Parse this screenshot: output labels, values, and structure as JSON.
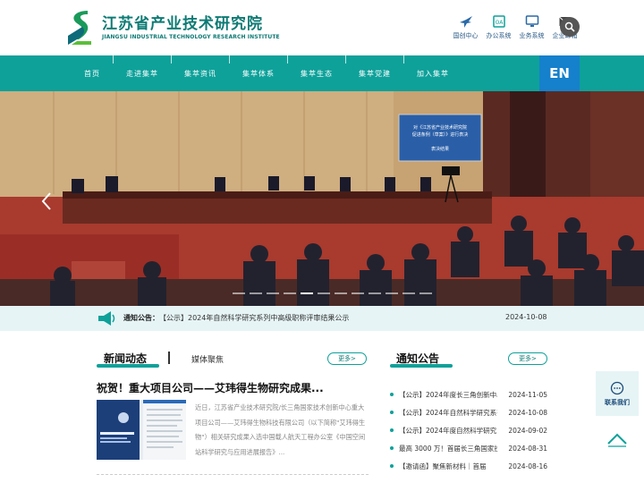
{
  "header": {
    "logo_cn": "江苏省产业技术研究院",
    "logo_en": "JIANGSU INDUSTRIAL TECHNOLOGY RESEARCH INSTITUTE",
    "top_links": [
      {
        "label": "国创中心",
        "icon": "bird-icon"
      },
      {
        "label": "办公系统",
        "icon": "oa-icon"
      },
      {
        "label": "业务系统",
        "icon": "monitor-icon"
      },
      {
        "label": "企业邮箱",
        "icon": "mail-icon"
      }
    ],
    "search_icon": "search-icon"
  },
  "nav": {
    "items": [
      "首页",
      "走进集萃",
      "集萃资讯",
      "集萃体系",
      "集萃生态",
      "集萃党建",
      "加入集萃"
    ],
    "en_label": "EN"
  },
  "banner": {
    "screen_text_1": "对《江苏省产业技术研究院",
    "screen_text_2": "促进条例（草案）》进行表决",
    "screen_text_3": "表决结果"
  },
  "notice_bar": {
    "label": "通知公告：",
    "text": "【公示】2024年自然科学研究系列中高级职称评审结果公示",
    "date": "2024-10-08"
  },
  "news": {
    "title": "新闻动态",
    "tab2": "媒体聚焦",
    "more": "更多>",
    "headline": "祝贺！重大项目公司——艾玮得生物研究成果...",
    "summary": "近日，江苏省产业技术研究院/长三角国家技术创新中心重大项目公司——艾玮得生物科技有限公司（以下简称\"艾玮得生物\"）相关研究成果入选中国载人航天工程办公室《中国空间站科学研究与应用进展报告》..."
  },
  "notices": {
    "title": "通知公告",
    "more": "更多>",
    "items": [
      {
        "title": "【公示】2024年度长三角创新中心",
        "date": "2024-11-05"
      },
      {
        "title": "【公示】2024年自然科学研究系列",
        "date": "2024-10-08"
      },
      {
        "title": "【公示】2024年度自然科学研究",
        "date": "2024-09-02"
      },
      {
        "title": "最高 3000 万！首届长三角国家技术创新",
        "date": "2024-08-31"
      },
      {
        "title": "【邀请函】聚焦新材料｜首届",
        "date": "2024-08-16"
      }
    ]
  },
  "float": {
    "contact_label": "联系我们"
  },
  "colors": {
    "teal": "#0ea19a",
    "blue": "#1580cc",
    "dark_teal": "#0d7a74"
  }
}
